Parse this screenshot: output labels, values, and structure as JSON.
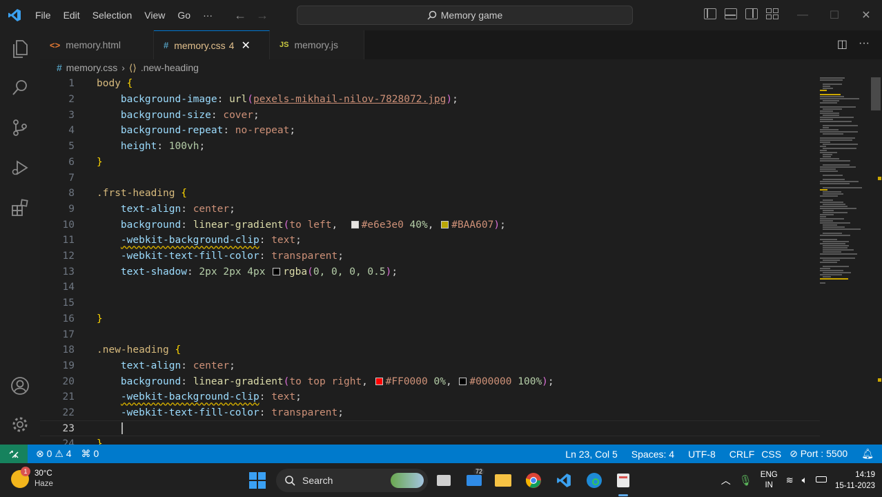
{
  "menu": [
    "File",
    "Edit",
    "Selection",
    "View",
    "Go",
    "···"
  ],
  "search": {
    "label": "Memory game"
  },
  "tabs": [
    {
      "name": "memory.html",
      "icon": "<>",
      "active": false
    },
    {
      "name": "memory.css",
      "badge": "4",
      "icon": "#",
      "active": true
    },
    {
      "name": "memory.js",
      "icon": "JS",
      "active": false
    }
  ],
  "breadcrumb": {
    "file": "memory.css",
    "symbol": ".new-heading"
  },
  "line_numbers": [
    "1",
    "2",
    "3",
    "4",
    "5",
    "6",
    "7",
    "8",
    "9",
    "10",
    "11",
    "12",
    "13",
    "14",
    "15",
    "16",
    "17",
    "18",
    "19",
    "20",
    "21",
    "22",
    "23",
    "24"
  ],
  "code": {
    "l1": {
      "sel": "body",
      "brace": "{"
    },
    "l2": {
      "prop": "background-image",
      "fn": "url",
      "link": "pexels-mikhail-nilov-7828072.jpg"
    },
    "l3": {
      "prop": "background-size",
      "val": "cover"
    },
    "l4": {
      "prop": "background-repeat",
      "val": "no-repeat"
    },
    "l5": {
      "prop": "height",
      "num": "100vh"
    },
    "l6": {
      "brace": "}"
    },
    "l8": {
      "sel": ".frst-heading",
      "brace": "{"
    },
    "l9": {
      "prop": "text-align",
      "val": "center"
    },
    "l10": {
      "prop": "background",
      "fn": "linear-gradient",
      "dir": "to left",
      "c1": "#e6e3e0",
      "p1": "40%",
      "c2": "#BAA607"
    },
    "l11": {
      "prop": "-webkit-background-clip",
      "val": "text"
    },
    "l12": {
      "prop": "-webkit-text-fill-color",
      "val": "transparent"
    },
    "l13": {
      "prop": "text-shadow",
      "nums": "2px 2px 4px",
      "fn": "rgba",
      "args": "0, 0, 0, 0.5"
    },
    "l16": {
      "brace": "}"
    },
    "l18": {
      "sel": ".new-heading",
      "brace": "{"
    },
    "l19": {
      "prop": "text-align",
      "val": "center"
    },
    "l20": {
      "prop": "background",
      "fn": "linear-gradient",
      "dir": "to top right",
      "c1": "#FF0000",
      "p1": "0%",
      "c2": "#000000",
      "p2": "100%"
    },
    "l21": {
      "prop": "-webkit-background-clip",
      "val": "text"
    },
    "l22": {
      "prop": "-webkit-text-fill-color",
      "val": "transparent"
    }
  },
  "swatches": {
    "e6e3e0": "#e6e3e0",
    "BAA607": "#BAA607",
    "rgba": "#000000",
    "FF0000": "#FF0000",
    "000000": "#000000"
  },
  "status": {
    "errors": "0",
    "warnings": "4",
    "ports_count": "0",
    "position": "Ln 23, Col 5",
    "spaces": "Spaces: 4",
    "encoding": "UTF-8",
    "eol": "CRLF",
    "language": "CSS",
    "port": "Port : 5500"
  },
  "taskbar": {
    "weather_temp": "30°C",
    "weather_desc": "Haze",
    "weather_badge": "1",
    "search": "Search",
    "mail_badge": "72",
    "lang1": "ENG",
    "lang2": "IN",
    "time": "14:19",
    "date": "15-11-2023"
  },
  "colors": {
    "accent": "#007acc",
    "remote": "#16825d",
    "active_tab_text": "#e2c08d"
  }
}
